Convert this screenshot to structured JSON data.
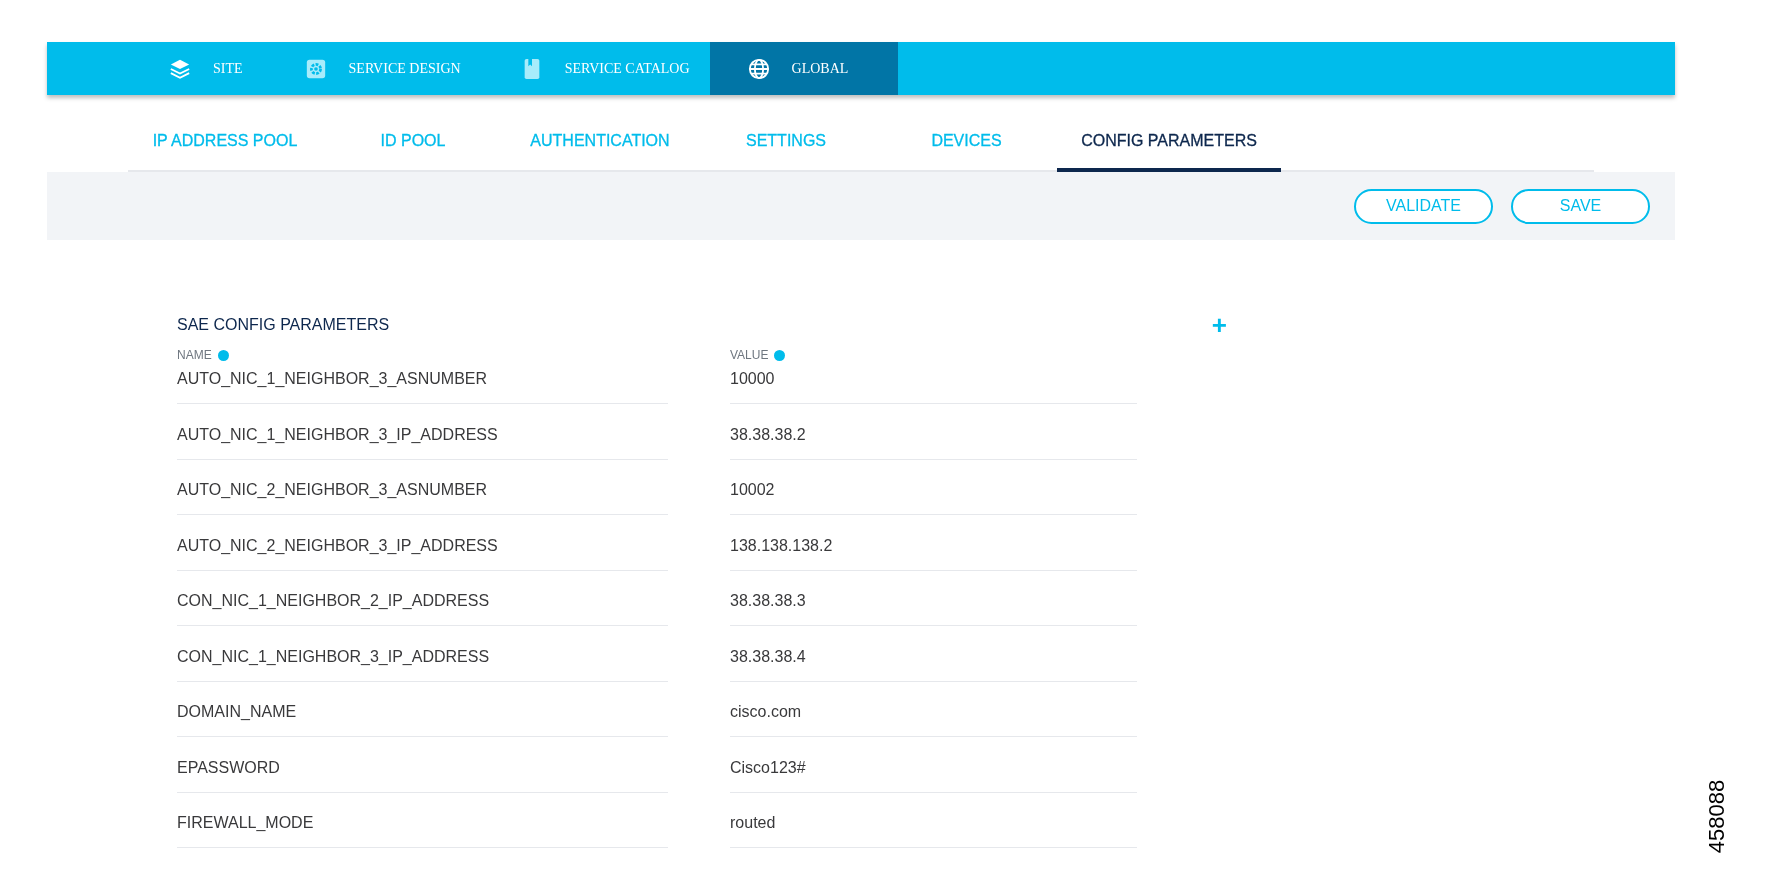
{
  "top_nav": [
    {
      "label": "SITE",
      "kind": "layers",
      "selected": false
    },
    {
      "label": "SERVICE DESIGN",
      "kind": "gear",
      "selected": false
    },
    {
      "label": "SERVICE CATALOG",
      "kind": "book",
      "selected": false
    },
    {
      "label": "GLOBAL",
      "kind": "globe",
      "selected": true
    }
  ],
  "tabs": [
    {
      "label": "IP ADDRESS POOL",
      "selected": false
    },
    {
      "label": "ID POOL",
      "selected": false
    },
    {
      "label": "AUTHENTICATION",
      "selected": false
    },
    {
      "label": "SETTINGS",
      "selected": false
    },
    {
      "label": "DEVICES",
      "selected": false
    },
    {
      "label": "CONFIG PARAMETERS",
      "selected": true
    }
  ],
  "toolbar": {
    "buttons": [
      "VALIDATE",
      "SAVE"
    ]
  },
  "section": {
    "title": "SAE CONFIG PARAMETERS",
    "add_button": "+",
    "columns": [
      "NAME",
      "VALUE"
    ],
    "rows": [
      {
        "name": "AUTO_NIC_1_NEIGHBOR_3_ASNUMBER",
        "value": "10000"
      },
      {
        "name": "AUTO_NIC_1_NEIGHBOR_3_IP_ADDRESS",
        "value": "38.38.38.2"
      },
      {
        "name": "AUTO_NIC_2_NEIGHBOR_3_ASNUMBER",
        "value": "10002"
      },
      {
        "name": "AUTO_NIC_2_NEIGHBOR_3_IP_ADDRESS",
        "value": "138.138.138.2"
      },
      {
        "name": "CON_NIC_1_NEIGHBOR_2_IP_ADDRESS",
        "value": "38.38.38.3"
      },
      {
        "name": "CON_NIC_1_NEIGHBOR_3_IP_ADDRESS",
        "value": "38.38.38.4"
      },
      {
        "name": "DOMAIN_NAME",
        "value": "cisco.com"
      },
      {
        "name": "EPASSWORD",
        "value": "Cisco123#"
      },
      {
        "name": "FIREWALL_MODE",
        "value": "routed"
      }
    ]
  },
  "figure_id": "458088"
}
